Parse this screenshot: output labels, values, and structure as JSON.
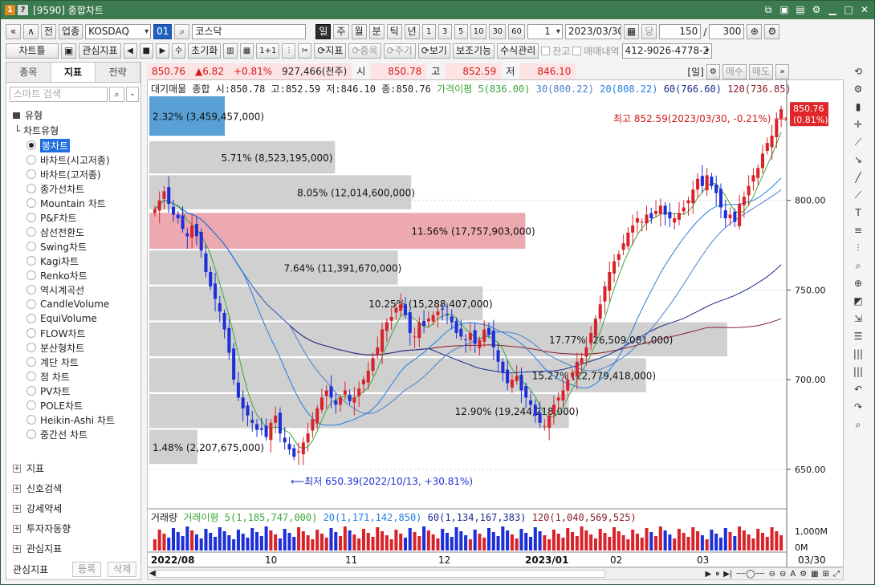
{
  "window": {
    "badge_num": "1",
    "badge_help": "?",
    "title": "[9590] 종합차트"
  },
  "toolbar1": {
    "prev": "«",
    "up": "∧",
    "all": "전",
    "sector": "업종",
    "market": "KOSDAQ",
    "code_btn": "01",
    "name": "코스닥",
    "periods": [
      "일",
      "주",
      "월",
      "분",
      "틱",
      "년"
    ],
    "period_active": "일",
    "intervals": [
      "1",
      "3",
      "5",
      "10",
      "30",
      "60"
    ],
    "count_value": "1",
    "date": "2023/03/30",
    "current_label": "당",
    "display_count": "150",
    "slash": "/",
    "total_count": "300"
  },
  "toolbar2": {
    "chart_type": "차트틀",
    "watch_indicator": "관심지표",
    "reset": "초기화",
    "one_plus_one": "1+1",
    "indicator": "지표",
    "item": "종목",
    "cycle": "주기",
    "view": "보기",
    "aux": "보조기능",
    "formula": "수식관리",
    "balance": "잔고",
    "trade_history": "매매내역",
    "account": "412-9026-4778-2"
  },
  "left_panel": {
    "tabs": [
      "종목",
      "지표",
      "전략"
    ],
    "active_tab": "지표",
    "search_placeholder": "스마트 검색",
    "category": "유형",
    "subcategory": "차트유형",
    "chart_types": [
      "봉차트",
      "바차트(시고저종)",
      "바차트(고저종)",
      "종가선차트",
      "Mountain 차트",
      "P&F차트",
      "삼선전환도",
      "Swing차트",
      "Kagi차트",
      "Renko차트",
      "역시계곡선",
      "CandleVolume",
      "EquiVolume",
      "FLOW차트",
      "분산형차트",
      "계단 차트",
      "점 차트",
      "PV차트",
      "POLE차트",
      "Heikin-Ashi 차트",
      "중간선 차트"
    ],
    "selected_type": "봉차트",
    "groups": [
      "지표",
      "신호검색",
      "강세약세",
      "투자자동향",
      "관심지표"
    ],
    "bottom_label": "관심지표",
    "register": "등록",
    "delete": "삭제"
  },
  "quote": {
    "price": "850.76",
    "change": "▲6.82",
    "change_pct": "+0.81%",
    "volume": "927,466(천주)",
    "open_label": "시",
    "open": "850.78",
    "high_label": "고",
    "high": "852.59",
    "low_label": "저",
    "low": "846.10",
    "period_label": "[일]",
    "buy": "매수",
    "sell": "매도"
  },
  "legend": {
    "name": "대기매물",
    "summary": "종합 시:850.78 고:852.59 저:846.10 종:850.76",
    "ma5": "가격이평 5(836.00)",
    "ma30": "30(800.22)",
    "ma20": "20(808.22)",
    "ma60": "60(766.60)",
    "ma120": "120(736.85)"
  },
  "volume_legend": {
    "name": "거래량",
    "ma5": "거래이평 5(1,185,747,000)",
    "ma20": "20(1,171,142,850)",
    "ma60": "60(1,134,167,383)",
    "ma120": "120(1,040,569,525)"
  },
  "annotations": {
    "high": "최고 852.59(2023/03/30, -0.21%)",
    "low": "최저 650.39(2022/10/13, +30.81%)",
    "last_price": "850.76",
    "last_pct": "(0.81%)"
  },
  "colors": {
    "up": "#d8232a",
    "down": "#1d2fd6",
    "ma5": "#3aa63a",
    "ma20": "#1f7fe0",
    "ma30": "#4a7fd0",
    "ma60": "#1c2a8c",
    "ma120": "#8a1c2a",
    "supply_bar": "#c8c8c8",
    "supply_current": "#e8949c",
    "supply_top": "#3b8fcf",
    "title_bar": "#3c7a4f"
  },
  "chart_data": {
    "type": "candlestick",
    "y_range": [
      628,
      858
    ],
    "y_ticks": [
      "650.00",
      "700.00",
      "750.00",
      "800.00"
    ],
    "x_labels": [
      "2022/08",
      "10",
      "11",
      "12",
      "2023/01",
      "02",
      "03",
      "03/30"
    ],
    "last_close": 850.76,
    "supply_profile": [
      {
        "low": 836,
        "high": 858,
        "label": "2.32% (3,459,457,000)",
        "pct": 2.32
      },
      {
        "low": 815,
        "high": 833,
        "label": "5.71% (8,523,195,000)",
        "pct": 5.71
      },
      {
        "low": 795,
        "high": 814,
        "label": "8.05% (12,014,600,000)",
        "pct": 8.05
      },
      {
        "low": 773,
        "high": 793,
        "label": "11.56% (17,757,903,000)",
        "pct": 11.56
      },
      {
        "low": 753,
        "high": 772,
        "label": "7.64% (11,391,670,000)",
        "pct": 7.64
      },
      {
        "low": 733,
        "high": 752,
        "label": "10.25% (15,288,407,000)",
        "pct": 10.25
      },
      {
        "low": 713,
        "high": 732,
        "label": "17.77% (26,509,081,000)",
        "pct": 17.77
      },
      {
        "low": 693,
        "high": 712,
        "label": "15.27% (22,779,418,000)",
        "pct": 15.27
      },
      {
        "low": 673,
        "high": 692,
        "label": "12.90% (19,244,218,000)",
        "pct": 12.9
      },
      {
        "low": 653,
        "high": 672,
        "label": "1.48% (2,207,675,000)",
        "pct": 1.48
      }
    ],
    "volume_ticks": [
      "1,000M",
      "0M"
    ],
    "close_series": [
      795,
      800,
      805,
      798,
      792,
      790,
      784,
      780,
      786,
      780,
      772,
      760,
      752,
      745,
      738,
      728,
      715,
      700,
      690,
      684,
      680,
      676,
      672,
      672,
      668,
      676,
      680,
      670,
      665,
      661,
      657,
      660,
      665,
      670,
      678,
      684,
      690,
      694,
      690,
      686,
      690,
      694,
      688,
      690,
      695,
      700,
      705,
      712,
      718,
      728,
      732,
      735,
      740,
      742,
      736,
      726,
      724,
      732,
      730,
      734,
      736,
      738,
      739,
      736,
      732,
      726,
      724,
      722,
      726,
      720,
      722,
      728,
      725,
      718,
      710,
      704,
      698,
      700,
      702,
      694,
      690,
      686,
      680,
      676,
      674,
      680,
      686,
      690,
      694,
      700,
      704,
      710,
      712,
      718,
      726,
      734,
      742,
      752,
      760,
      766,
      770,
      776,
      782,
      786,
      790,
      788,
      792,
      790,
      794,
      797,
      792,
      790,
      790,
      793,
      796,
      800,
      806,
      812,
      808,
      814,
      808,
      804,
      796,
      790,
      792,
      788,
      798,
      802,
      808,
      814,
      818,
      826,
      832,
      836,
      845,
      850.76
    ]
  }
}
